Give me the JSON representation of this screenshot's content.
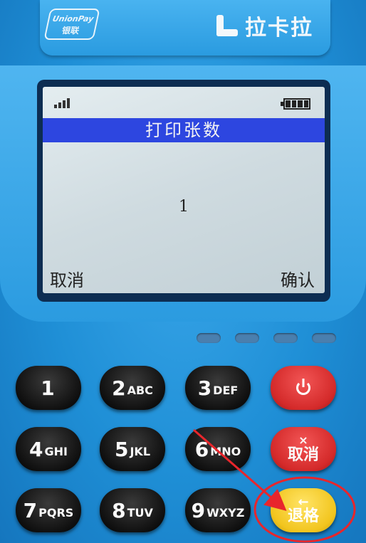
{
  "device": {
    "unionpay_line1": "UnionPay",
    "unionpay_line2": "银联",
    "brand": "拉卡拉"
  },
  "screen": {
    "title": "打印张数",
    "value": "1",
    "soft_left": "取消",
    "soft_right": "确认"
  },
  "keypad": {
    "keys": [
      {
        "num": "1",
        "letters": ""
      },
      {
        "num": "2",
        "letters": "ABC"
      },
      {
        "num": "3",
        "letters": "DEF"
      },
      {
        "num": "4",
        "letters": "GHI"
      },
      {
        "num": "5",
        "letters": "JKL"
      },
      {
        "num": "6",
        "letters": "MNO"
      },
      {
        "num": "7",
        "letters": "PQRS"
      },
      {
        "num": "8",
        "letters": "TUV"
      },
      {
        "num": "9",
        "letters": "WXYZ"
      }
    ],
    "cancel_icon": "×",
    "cancel_label": "取消",
    "back_icon": "←",
    "back_label": "退格"
  },
  "colors": {
    "device_blue": "#1f8fd6",
    "title_bar": "#2d46e0",
    "red_key": "#d42a2a",
    "yellow_key": "#f2c51e",
    "annotation": "#e8262c"
  }
}
